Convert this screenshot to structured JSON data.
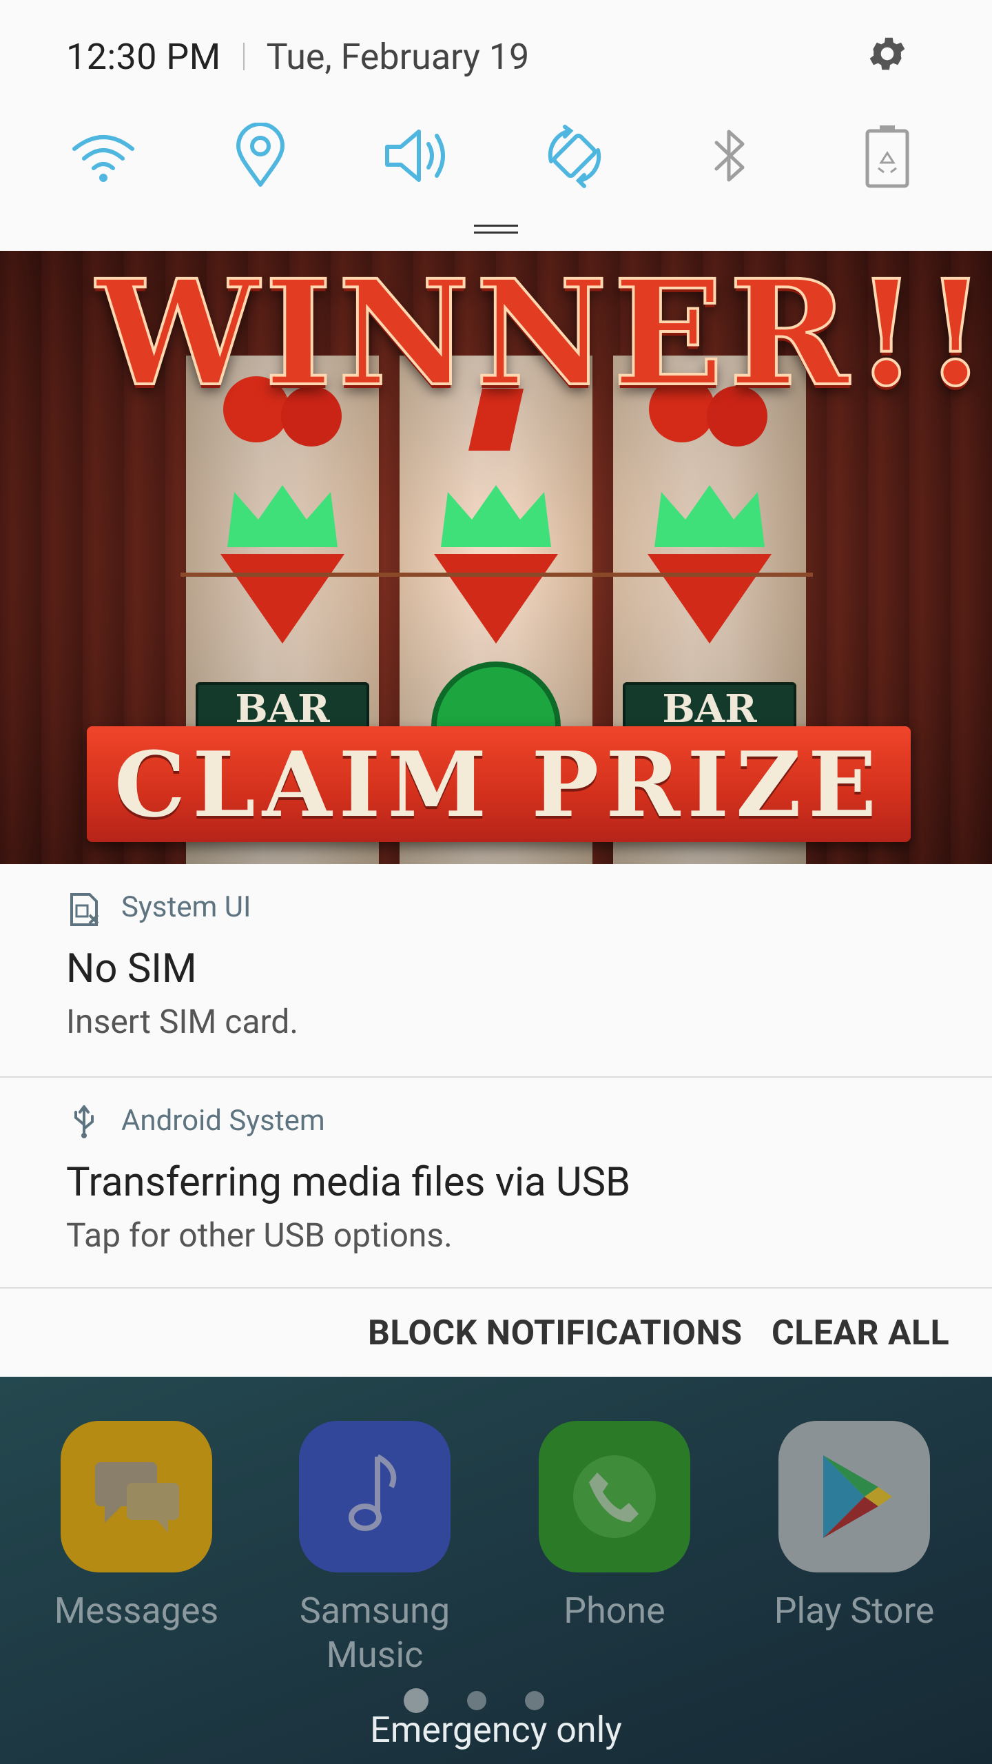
{
  "status": {
    "time": "12:30 PM",
    "date": "Tue, February 19"
  },
  "quick_settings": [
    {
      "name": "wifi-icon",
      "active": true
    },
    {
      "name": "location-icon",
      "active": true
    },
    {
      "name": "sound-icon",
      "active": true
    },
    {
      "name": "auto-rotate-icon",
      "active": true
    },
    {
      "name": "bluetooth-icon",
      "active": false
    },
    {
      "name": "power-saving-icon",
      "active": false
    }
  ],
  "ad": {
    "headline": "WINNER!!!",
    "cta": "CLAIM PRIZE",
    "reel_symbol": "BAR"
  },
  "notifications": [
    {
      "app": "System UI",
      "title": "No SIM",
      "text": "Insert SIM card."
    },
    {
      "app": "Android System",
      "title": "Transferring media files via USB",
      "text": "Tap for other USB options."
    }
  ],
  "actions": {
    "block": "BLOCK NOTIFICATIONS",
    "clear": "CLEAR ALL"
  },
  "dock": [
    {
      "label": "Messages",
      "color": "#c99a12"
    },
    {
      "label": "Samsung Music",
      "color": "#3b4fa8"
    },
    {
      "label": "Phone",
      "color": "#2f8a2c"
    },
    {
      "label": "Play Store",
      "color": "#8f979b"
    }
  ],
  "footer": {
    "emergency": "Emergency only"
  },
  "colors": {
    "accent": "#4fb6e0",
    "inactive_icon": "#9e9e9e"
  }
}
